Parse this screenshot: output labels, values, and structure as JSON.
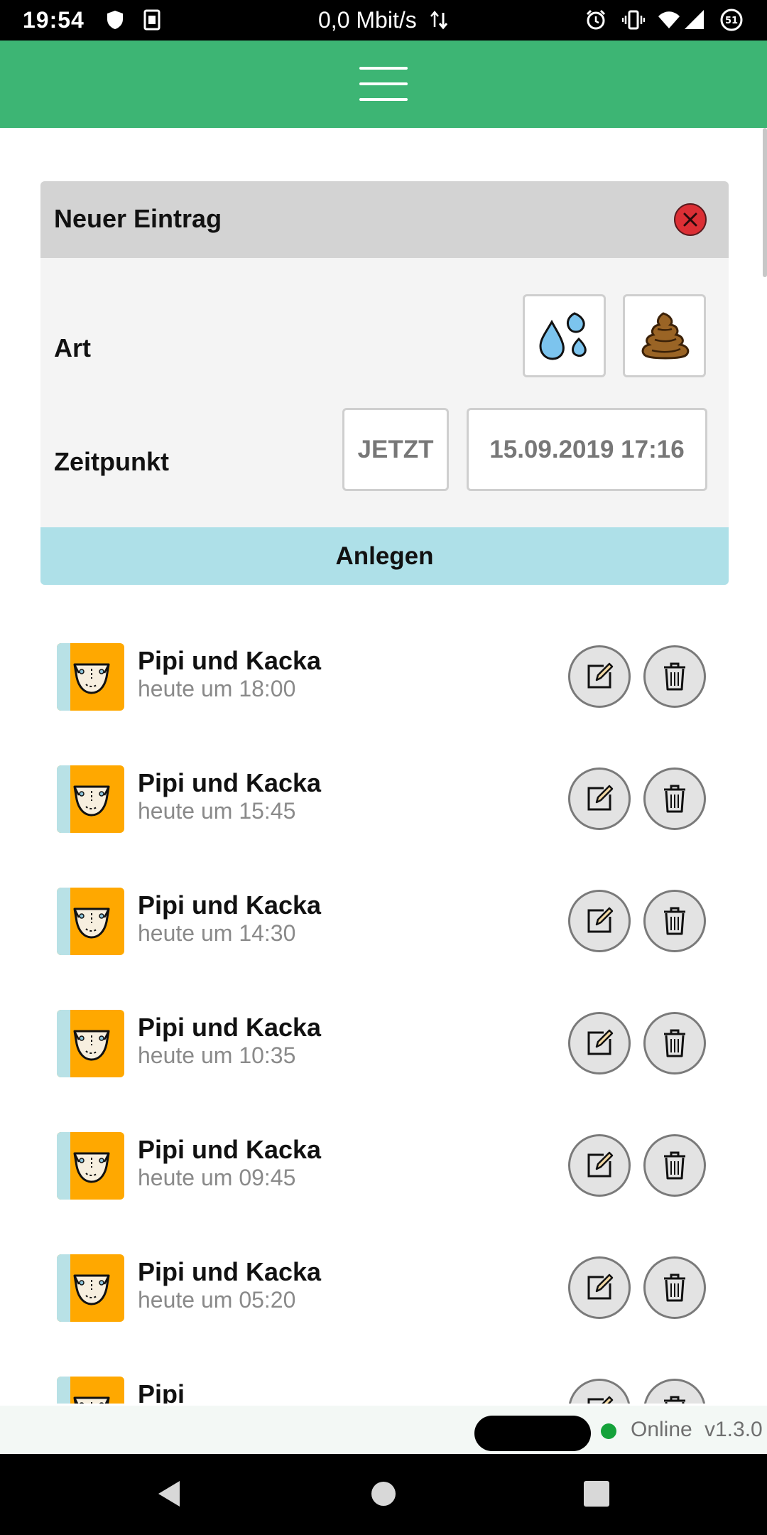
{
  "status_bar": {
    "time": "19:54",
    "network_speed": "0,0 Mbit/s",
    "battery": "51",
    "icons": [
      "shield-icon",
      "sim-icon",
      "data-arrows-icon",
      "alarm-icon",
      "vibrate-icon",
      "wifi-icon",
      "signal-icon",
      "battery-icon"
    ]
  },
  "header": {
    "menu_icon": "hamburger-menu-icon",
    "color": "#3db574"
  },
  "new_entry": {
    "title": "Neuer Eintrag",
    "close_icon": "close-icon",
    "type_label": "Art",
    "type_options": [
      "drops-icon",
      "poop-icon"
    ],
    "time_label": "Zeitpunkt",
    "now_button": "JETZT",
    "datetime_value": "15.09.2019 17:16",
    "submit_label": "Anlegen"
  },
  "entries": [
    {
      "title": "Pipi und Kacka",
      "time": "heute um 18:00"
    },
    {
      "title": "Pipi und Kacka",
      "time": "heute um 15:45"
    },
    {
      "title": "Pipi und Kacka",
      "time": "heute um 14:30"
    },
    {
      "title": "Pipi und Kacka",
      "time": "heute um 10:35"
    },
    {
      "title": "Pipi und Kacka",
      "time": "heute um 09:45"
    },
    {
      "title": "Pipi und Kacka",
      "time": "heute um 05:20"
    },
    {
      "title": "Pipi",
      "time": ""
    }
  ],
  "footer": {
    "status": "Online",
    "status_color": "#14a23a",
    "version": "v1.3.0"
  },
  "nav": {
    "icons": [
      "back-icon",
      "home-icon",
      "recents-icon"
    ]
  }
}
